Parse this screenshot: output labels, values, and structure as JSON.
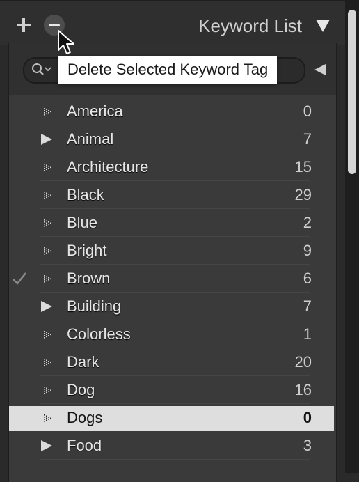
{
  "header": {
    "title": "Keyword List",
    "add_icon": "plus-icon",
    "remove_icon": "minus-icon",
    "collapse_icon": "triangle-down-icon"
  },
  "filter": {
    "search_icon": "search-icon",
    "value": "",
    "menu_icon": "triangle-left-icon"
  },
  "tooltip": {
    "text": "Delete Selected Keyword Tag"
  },
  "keywords": [
    {
      "name": "America",
      "count": "0",
      "expandable": false,
      "checked": false,
      "selected": false
    },
    {
      "name": "Animal",
      "count": "7",
      "expandable": true,
      "checked": false,
      "selected": false
    },
    {
      "name": "Architecture",
      "count": "15",
      "expandable": false,
      "checked": false,
      "selected": false
    },
    {
      "name": "Black",
      "count": "29",
      "expandable": false,
      "checked": false,
      "selected": false
    },
    {
      "name": "Blue",
      "count": "2",
      "expandable": false,
      "checked": false,
      "selected": false
    },
    {
      "name": "Bright",
      "count": "9",
      "expandable": false,
      "checked": false,
      "selected": false
    },
    {
      "name": "Brown",
      "count": "6",
      "expandable": false,
      "checked": true,
      "selected": false
    },
    {
      "name": "Building",
      "count": "7",
      "expandable": true,
      "checked": false,
      "selected": false
    },
    {
      "name": "Colorless",
      "count": "1",
      "expandable": false,
      "checked": false,
      "selected": false
    },
    {
      "name": "Dark",
      "count": "20",
      "expandable": false,
      "checked": false,
      "selected": false
    },
    {
      "name": "Dog",
      "count": "16",
      "expandable": false,
      "checked": false,
      "selected": false
    },
    {
      "name": "Dogs",
      "count": "0",
      "expandable": false,
      "checked": false,
      "selected": true
    },
    {
      "name": "Food",
      "count": "3",
      "expandable": true,
      "checked": false,
      "selected": false
    }
  ],
  "colors": {
    "panel_bg": "#3a3a3a",
    "header_bg": "#2f2f2f",
    "selected_row": "#dedede",
    "text": "#e6e6e6"
  }
}
